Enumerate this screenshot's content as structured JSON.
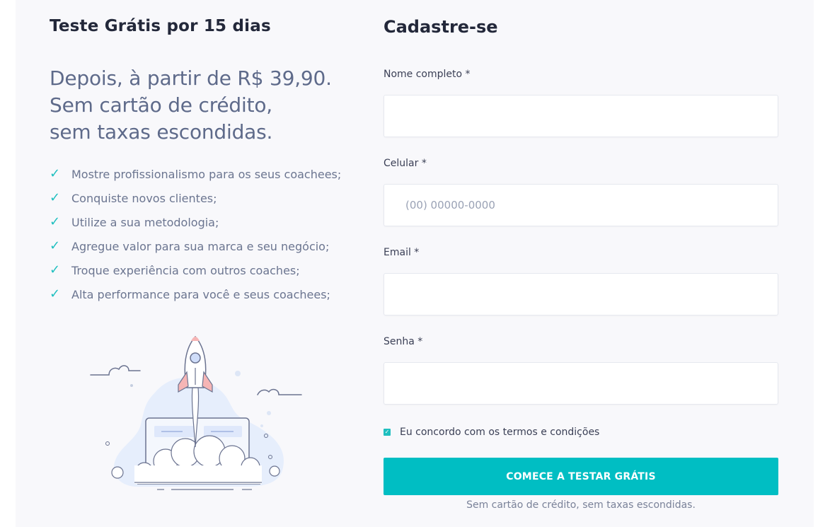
{
  "trial": {
    "title": "Teste Grátis por 15 dias",
    "tagline": [
      "Depois, à partir de R$ 39,90.",
      "Sem cartão de crédito,",
      "sem taxas escondidas."
    ],
    "benefits": [
      "Mostre profissionalismo para os seus coachees;",
      "Conquiste novos clientes;",
      "Utilize a sua metodologia;",
      "Agregue valor para sua marca e seu negócio;",
      "Troque experiência com outros coaches;",
      "Alta performance para você e seus coachees;"
    ],
    "illustration_icon": "rocket-launch-illustration"
  },
  "signup": {
    "title": "Cadastre-se",
    "fields": {
      "name": {
        "label": "Nome completo *",
        "value": "",
        "placeholder": ""
      },
      "phone": {
        "label": "Celular *",
        "value": "",
        "placeholder": "(00) 00000-0000"
      },
      "email": {
        "label": "Email *",
        "value": "",
        "placeholder": ""
      },
      "password": {
        "label": "Senha *",
        "value": "",
        "placeholder": ""
      }
    },
    "terms": {
      "label": "Eu concordo com os termos e condições",
      "checked": true
    },
    "submit_label": "COMECE A TESTAR GRÁTIS",
    "footnote": "Sem cartão de crédito, sem taxas escondidas."
  },
  "colors": {
    "accent": "#00bec3",
    "check": "#1fbfbf",
    "heading": "#23283a",
    "tagline": "#5e6a8a",
    "background": "#f8f8fb"
  }
}
